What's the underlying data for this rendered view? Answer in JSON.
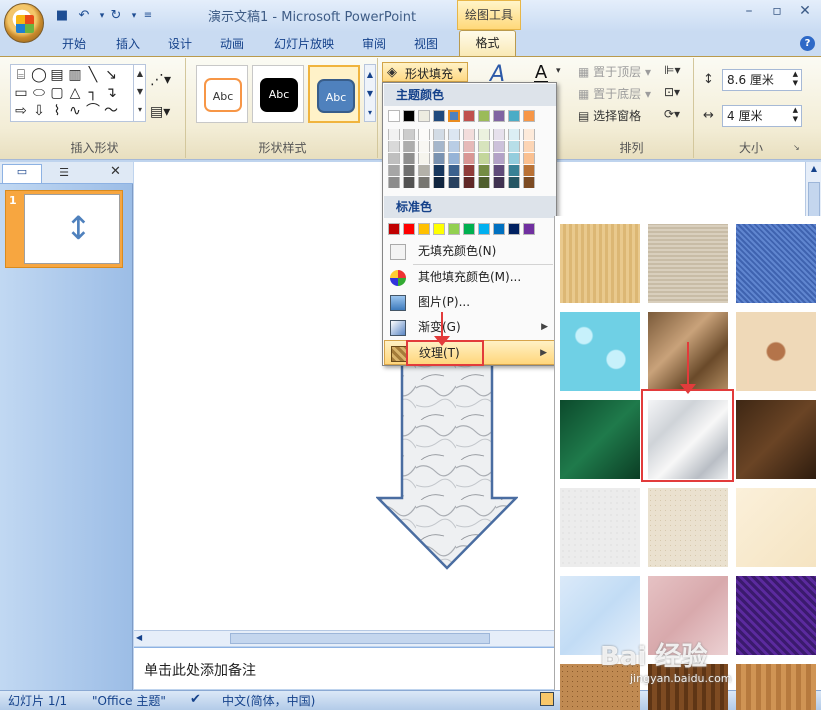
{
  "window": {
    "doc_title": "演示文稿1 - Microsoft PowerPoint",
    "context_tab_label": "绘图工具"
  },
  "tabs": [
    "开始",
    "插入",
    "设计",
    "动画",
    "幻灯片放映",
    "审阅",
    "视图",
    "格式"
  ],
  "active_tab": "格式",
  "ribbon": {
    "insert_shapes_label": "插入形状",
    "shape_styles_label": "形状样式",
    "style_thumbs": [
      "Abc",
      "Abc",
      "Abc"
    ],
    "shape_fill_button": "形状填充",
    "arrange": {
      "bring_front": "置于顶层",
      "send_back": "置于底层",
      "selection_pane": "选择窗格",
      "label": "排列"
    },
    "size": {
      "height_value": "8.6 厘米",
      "width_value": "4 厘米",
      "label": "大小"
    }
  },
  "menu": {
    "theme_colors_title": "主题颜色",
    "standard_colors_title": "标准色",
    "items": [
      {
        "label": "无填充颜色(N)",
        "icon": "no-fill-icon"
      },
      {
        "label": "其他填充颜色(M)...",
        "icon": "palette-icon"
      },
      {
        "label": "图片(P)...",
        "icon": "picture-icon"
      },
      {
        "label": "渐变(G)",
        "icon": "gradient-icon"
      },
      {
        "label": "纹理(T)",
        "icon": "texture-icon"
      }
    ],
    "theme_top_row": [
      "#ffffff",
      "#000000",
      "#eeece1",
      "#1f497d",
      "#4f81bd",
      "#c0504d",
      "#9bbb59",
      "#8064a2",
      "#4bacc6",
      "#f79646"
    ],
    "standard_colors": [
      "#c00000",
      "#ff0000",
      "#ffc000",
      "#ffff00",
      "#92d050",
      "#00b050",
      "#00b0f0",
      "#0070c0",
      "#002060",
      "#7030a0"
    ]
  },
  "slide_panel": {
    "slide_number": "1"
  },
  "notes": {
    "placeholder": "单击此处添加备注"
  },
  "status": {
    "slide_info": "幻灯片 1/1",
    "theme": "\"Office 主题\"",
    "language": "中文(简体，中国)"
  },
  "watermark": {
    "text": "Bai 经验",
    "url": "jingyan.baidu.com"
  },
  "textures": [
    "papyrus",
    "canvas",
    "denim",
    "water-droplets",
    "paper-bag",
    "fish-fossil",
    "green-marble",
    "white-marble",
    "brown-marble",
    "granite",
    "sand",
    "parchment",
    "blue-tissue",
    "pink-tissue",
    "purple-mesh",
    "cork",
    "walnut",
    "oak"
  ]
}
